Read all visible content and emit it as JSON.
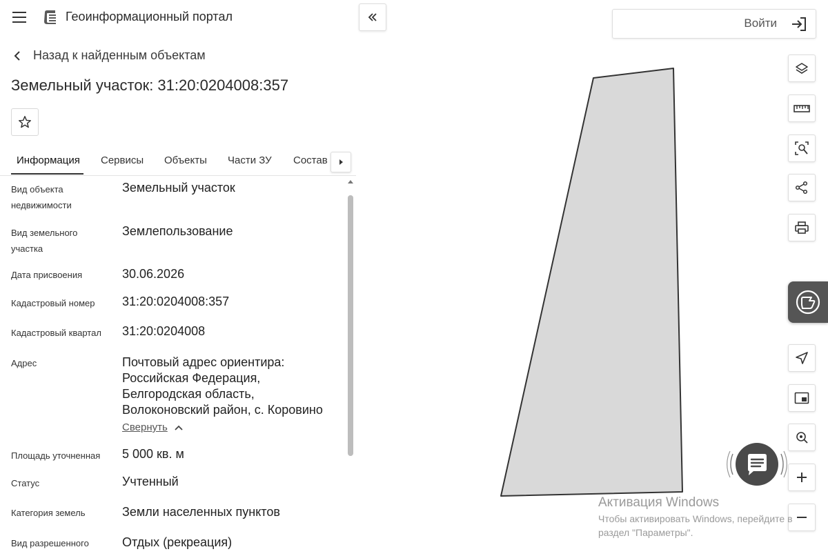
{
  "app": {
    "title": "Геоинформационный портал"
  },
  "nav": {
    "back_label": "Назад к найденным объектам"
  },
  "page": {
    "title": "Земельный участок: 31:20:0204008:357"
  },
  "tabs": [
    {
      "label": "Информация",
      "active": true
    },
    {
      "label": "Сервисы",
      "active": false
    },
    {
      "label": "Объекты",
      "active": false
    },
    {
      "label": "Части ЗУ",
      "active": false
    },
    {
      "label": "Состав",
      "active": false
    }
  ],
  "info": {
    "rows": [
      {
        "label": "Вид объекта недвижимости",
        "value": "Земельный участок"
      },
      {
        "label": "Вид земельного участка",
        "value": "Землепользование"
      },
      {
        "label": "Дата присвоения",
        "value": "30.06.2026"
      },
      {
        "label": "Кадастровый номер",
        "value": "31:20:0204008:357"
      },
      {
        "label": "Кадастровый квартал",
        "value": "31:20:0204008"
      },
      {
        "label": "Адрес",
        "value_lines": [
          "Почтовый адрес ориентира:",
          "Российская Федерация,",
          "Белгородская область,",
          "Волоконовский район, с. Коровино"
        ]
      },
      {
        "label": "Площадь уточненная",
        "value": "5 000 кв. м"
      },
      {
        "label": "Статус",
        "value": "Учтенный"
      },
      {
        "label": "Категория земель",
        "value": "Земли населенных пунктов"
      },
      {
        "label": "Вид разрешенного",
        "value": "Отдых (рекреация)"
      }
    ],
    "collapse_label": "Свернуть"
  },
  "map": {
    "login_label": "Войти",
    "tools": [
      "layers-icon",
      "ruler-icon",
      "select-area-icon",
      "share-icon",
      "print-icon",
      "navigate-icon",
      "minimap-icon",
      "locate-icon",
      "zoom-in-icon",
      "zoom-out-icon"
    ],
    "parcel_fill": "#d9d9d9",
    "parcel_stroke": "#333333"
  },
  "watermark": {
    "line1": "Активация Windows",
    "line2": "Чтобы активировать Windows, перейдите в",
    "line3": "раздел \"Параметры\"."
  },
  "colors": {
    "chat_tab": "#555555",
    "chat_bubble": "#4a4a4a",
    "scroll_thumb": "#bdbdbd"
  }
}
